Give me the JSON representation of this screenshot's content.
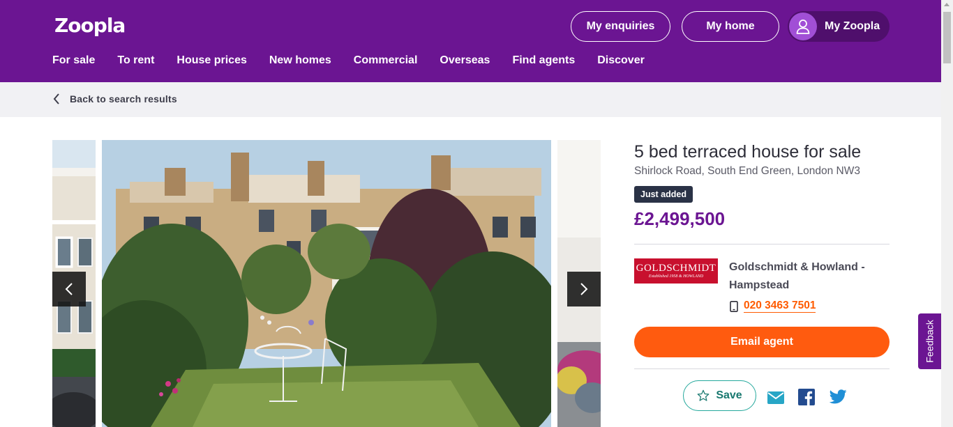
{
  "header": {
    "logo": "Zoopla",
    "buttons": {
      "enquiries": "My enquiries",
      "home": "My home",
      "my_zoopla": "My Zoopla"
    },
    "nav": [
      "For sale",
      "To rent",
      "House prices",
      "New homes",
      "Commercial",
      "Overseas",
      "Find agents",
      "Discover"
    ]
  },
  "breadcrumb": {
    "back_label": "Back to search results"
  },
  "listing": {
    "title": "5 bed terraced house for sale",
    "address": "Shirlock Road, South End Green, London NW3",
    "badge": "Just added",
    "price": "£2,499,500"
  },
  "agent": {
    "logo_name": "GOLDSCHMIDT",
    "logo_sub": "Established 1958   & HOWLAND",
    "name": "Goldschmidt & Howland - Hampstead",
    "phone": "020 3463 7501"
  },
  "actions": {
    "email_agent": "Email agent",
    "save": "Save"
  },
  "feedback": "Feedback",
  "colors": {
    "brand_purple": "#6b1592",
    "accent_orange": "#ff5b0f",
    "teal": "#24a89c",
    "badge_dark": "#2a3246"
  },
  "icons": {
    "back": "chevron-left-icon",
    "avatar": "user-icon",
    "phone": "mobile-phone-icon",
    "save": "star-outline-icon",
    "share_email": "envelope-icon",
    "share_facebook": "facebook-icon",
    "share_twitter": "twitter-icon",
    "gallery_prev": "chevron-left-icon",
    "gallery_next": "chevron-right-icon"
  }
}
